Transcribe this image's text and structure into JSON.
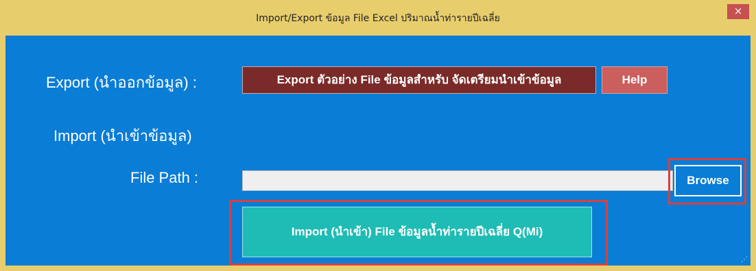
{
  "window": {
    "title": "Import/Export ข้อมูล File Excel ปริมาณน้ำท่ารายปีเฉลี่ย",
    "close_glyph": "×"
  },
  "export_section": {
    "label": "Export (นำออกข้อมูล) :",
    "export_button": "Export ตัวอย่าง File ข้อมูลสำหรับ จัดเตรียมนำเข้าข้อมูล",
    "help_button": "Help"
  },
  "import_section": {
    "label": "Import (นำเข้าข้อมูล)",
    "file_path_label": "File Path :",
    "file_path_value": "",
    "browse_button": "Browse",
    "import_button": "Import (นำเข้า) File ข้อมูลน้ำท่ารายปีเฉลี่ย Q(Mi)"
  },
  "colors": {
    "window_frame": "#e8cd6c",
    "client_bg": "#0a7dd6",
    "export_button": "#7a2a28",
    "help_button": "#cb5f5e",
    "import_button": "#1ebcb4",
    "highlight": "#d9403f"
  },
  "icons": {
    "close": "close-icon",
    "resize": "resize-grip-icon"
  }
}
